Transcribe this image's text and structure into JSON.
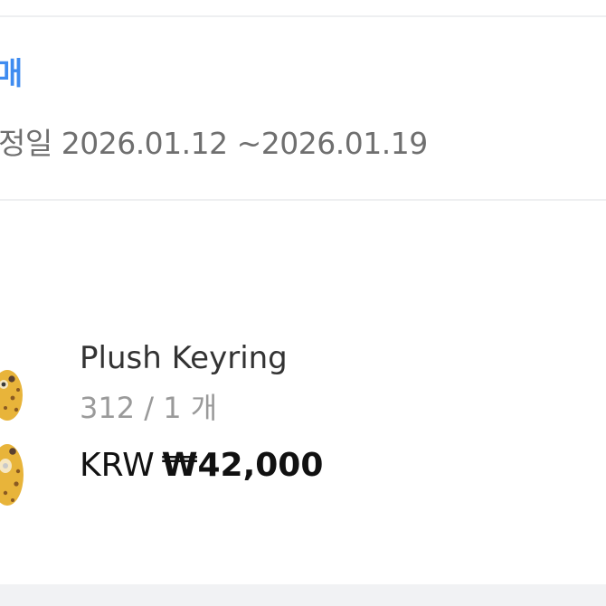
{
  "order": {
    "status": "매",
    "ship_date": "정일 2026.01.12 ~2026.01.19"
  },
  "product": {
    "name": "Plush Keyring",
    "quantity": "312 / 1 개",
    "price_currency": "KRW",
    "price_amount": "₩42,000"
  },
  "colors": {
    "status_blue": "#3f8cf0",
    "divider": "#eeeff1",
    "footer_band": "#f1f2f4"
  }
}
